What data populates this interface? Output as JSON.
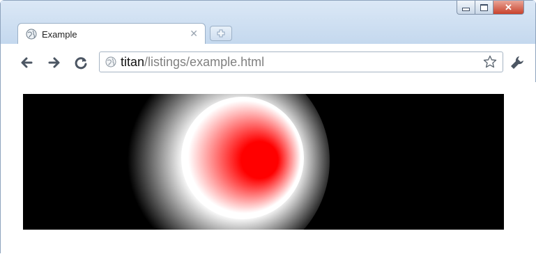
{
  "tab": {
    "title": "Example"
  },
  "address_bar": {
    "url_host": "titan",
    "url_path": "/listings/example.html"
  },
  "icons": {
    "favicon": "globe-icon",
    "close_tab": "close-icon",
    "new_tab": "plus-icon",
    "back": "arrow-left-icon",
    "forward": "arrow-right-icon",
    "reload": "reload-icon",
    "bookmark": "star-icon",
    "menu": "wrench-icon",
    "minimize": "minimize-icon",
    "maximize": "maximize-icon",
    "close_window": "close-window-icon"
  },
  "canvas": {
    "background": "#000000",
    "gradient_colors": [
      "#ff0000",
      "#ffffff",
      "#000000"
    ]
  }
}
